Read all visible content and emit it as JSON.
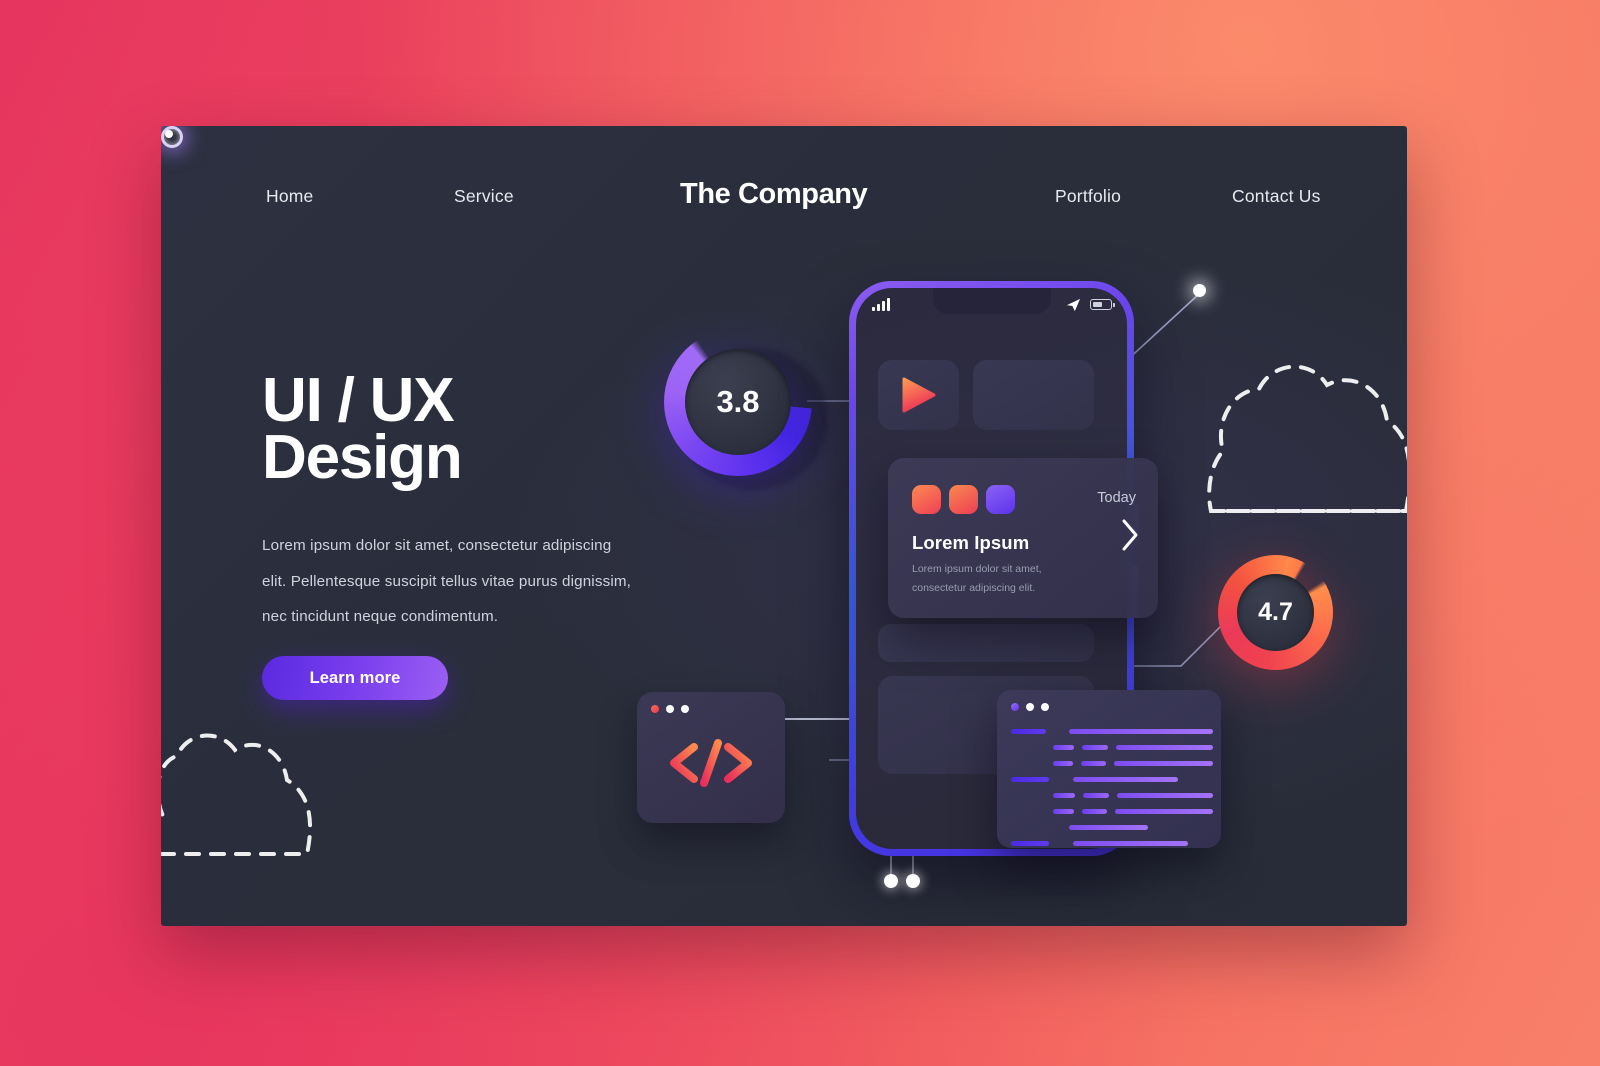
{
  "theme": {
    "bg_pink": "#E6355F",
    "bg_coral": "#F8806A",
    "panel_dark": "#2A2E3B",
    "accent_purple": "#6A3FEE",
    "accent_red": "#EF3F55",
    "accent_orange": "#FF8A4B"
  },
  "nav": {
    "brand": "The Company",
    "links": [
      {
        "label": "Home",
        "name": "nav-home"
      },
      {
        "label": "Service",
        "name": "nav-service"
      },
      {
        "label": "Portfolio",
        "name": "nav-portfolio"
      },
      {
        "label": "Contact Us",
        "name": "nav-contact"
      }
    ]
  },
  "hero": {
    "headline_line1": "UI / UX",
    "headline_line2": "Design",
    "paragraph": "Lorem ipsum dolor sit amet, consectetur adipiscing elit. Pellentesque suscipit tellus vitae purus dignissim, nec tincidunt neque condimentum.",
    "cta_label": "Learn more"
  },
  "gauges": [
    {
      "name": "rating-gauge-38",
      "value": "3.8",
      "color": "#6A3FEE",
      "percent": 64
    },
    {
      "name": "rating-gauge-47",
      "value": "4.7",
      "color": "#F04A4B",
      "percent": 93
    }
  ],
  "phone": {
    "status": {
      "signal_icon": "signal-bars-icon",
      "location_icon": "location-arrow-icon",
      "battery_icon": "battery-icon"
    },
    "tiles": [
      {
        "name": "media-play-tile",
        "icon": "play-icon"
      },
      {
        "name": "blank-tile",
        "icon": ""
      }
    ]
  },
  "info_card": {
    "today_label": "Today",
    "title": "Lorem Ipsum",
    "subtitle": "Lorem ipsum dolor sit amet, consectetur adipiscing elit.",
    "chevron_icon": "chevron-right-icon",
    "swatches": [
      "#EF3F55",
      "#EE3D54",
      "#5C33ED"
    ]
  },
  "code_card": {
    "glyph": "</>",
    "dots": [
      "#EC3557",
      "#FFFFFF",
      "#FFFFFF"
    ]
  },
  "editor": {
    "dots": [
      "#5F37EE",
      "#FFFFFF",
      "#FFFFFF"
    ],
    "rows": [
      {
        "indent": 0,
        "segments": [
          62,
          0,
          250
        ]
      },
      {
        "indent": 1,
        "segments": [
          42,
          52,
          190
        ]
      },
      {
        "indent": 1,
        "segments": [
          42,
          52,
          205
        ]
      },
      {
        "indent": 0,
        "segments": [
          62,
          0,
          170
        ]
      },
      {
        "indent": 1,
        "segments": [
          42,
          52,
          185
        ]
      },
      {
        "indent": 1,
        "segments": [
          42,
          52,
          200
        ]
      },
      {
        "indent": 1,
        "segments": [
          0,
          0,
          128
        ]
      },
      {
        "indent": 0,
        "segments": [
          62,
          0,
          185
        ]
      },
      {
        "indent": 1,
        "segments": [
          42,
          20,
          80
        ]
      }
    ]
  },
  "decor": {
    "cloud_right": "dashed-cloud-shape",
    "cloud_left": "dashed-cloud-shape",
    "nodes": [
      "connector-node-top-right",
      "connector-node-left",
      "connector-node-bottom-1",
      "connector-node-bottom-2"
    ]
  }
}
